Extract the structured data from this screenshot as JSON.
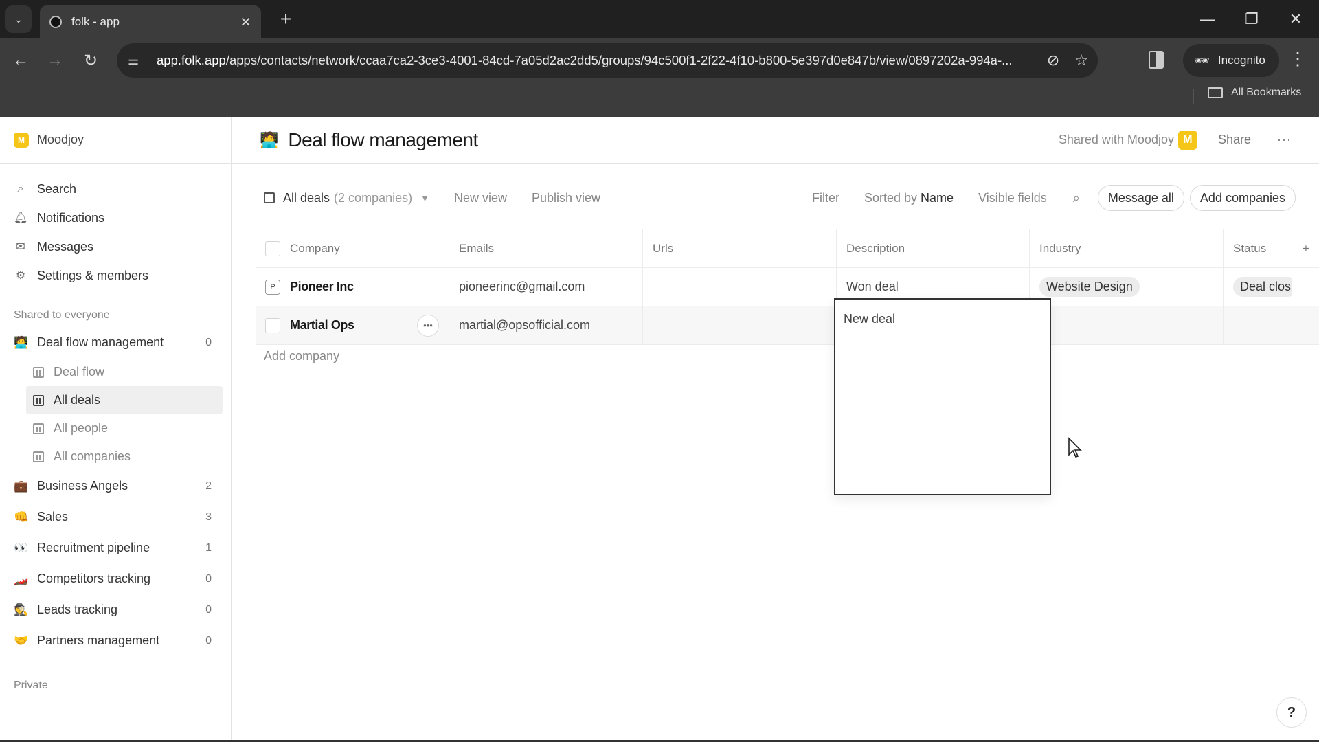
{
  "browser": {
    "tab_title": "folk - app",
    "url_host": "app.folk.app",
    "url_path": "/apps/contacts/network/ccaa7ca2-3ce3-4001-84cd-7a05d2ac2dd5/groups/94c500f1-2f22-4f10-b800-5e397d0e847b/view/0897202a-994a-...",
    "incognito_label": "Incognito",
    "bookmarks_label": "All Bookmarks"
  },
  "sidebar": {
    "workspace": {
      "initial": "M",
      "name": "Moodjoy"
    },
    "nav": [
      {
        "label": "Search",
        "icon": "search-icon"
      },
      {
        "label": "Notifications",
        "icon": "bell-icon"
      },
      {
        "label": "Messages",
        "icon": "mail-icon"
      },
      {
        "label": "Settings & members",
        "icon": "gear-icon"
      }
    ],
    "shared_label": "Shared to everyone",
    "groups": [
      {
        "emoji": "🧑‍💻",
        "name": "Deal flow management",
        "count": "0"
      },
      {
        "emoji": "💼",
        "name": "Business Angels",
        "count": "2"
      },
      {
        "emoji": "👊",
        "name": "Sales",
        "count": "3"
      },
      {
        "emoji": "👀",
        "name": "Recruitment pipeline",
        "count": "1"
      },
      {
        "emoji": "🏎️",
        "name": "Competitors tracking",
        "count": "0"
      },
      {
        "emoji": "🕵️",
        "name": "Leads tracking",
        "count": "0"
      },
      {
        "emoji": "🤝",
        "name": "Partners management",
        "count": "0"
      }
    ],
    "subviews": [
      {
        "label": "Deal flow",
        "active": false
      },
      {
        "label": "All deals",
        "active": true
      },
      {
        "label": "All people",
        "active": false
      },
      {
        "label": "All companies",
        "active": false
      }
    ],
    "private_label": "Private"
  },
  "header": {
    "emoji": "🧑‍💻",
    "title": "Deal flow management",
    "shared_with": "Shared with Moodjoy",
    "shared_initial": "M",
    "share_label": "Share",
    "more_label": "···"
  },
  "toolbar": {
    "view_name": "All deals",
    "view_count": "(2 companies)",
    "new_view": "New view",
    "publish_view": "Publish view",
    "filter": "Filter",
    "sorted_prefix": "Sorted by",
    "sorted_field": "Name",
    "visible_fields": "Visible fields",
    "message_all": "Message all",
    "add_companies": "Add companies"
  },
  "table": {
    "columns": [
      "Company",
      "Emails",
      "Urls",
      "Description",
      "Industry",
      "Status"
    ],
    "rows": [
      {
        "initial": "P",
        "company": "Pioneer Inc",
        "email": "pioneerinc@gmail.com",
        "url": "",
        "description": "Won deal",
        "industry": "Website Design",
        "status": "Deal clos"
      },
      {
        "initial": "",
        "company": "Martial Ops",
        "email": "martial@opsofficial.com",
        "url": "",
        "description": "New deal",
        "industry": "",
        "status": ""
      }
    ],
    "add_company": "Add company",
    "editor_value": "New deal"
  },
  "help_label": "?",
  "colors": {
    "workspace_accent": "#f5c518"
  }
}
